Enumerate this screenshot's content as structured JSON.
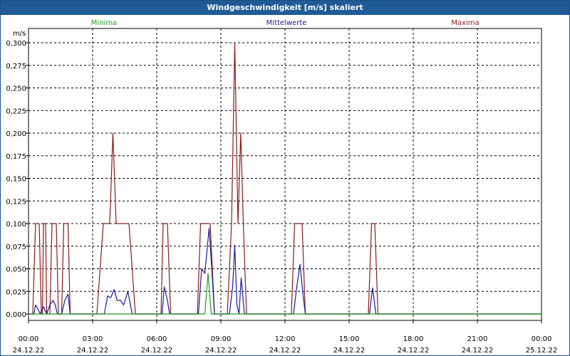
{
  "window": {
    "title": "Windgeschwindigkeit [m/s] skaliert"
  },
  "chart_data": {
    "type": "line",
    "title": "Windgeschwindigkeit [m/s] skaliert",
    "ylabel": "m/s",
    "xlabel": "",
    "ylim": [
      0,
      0.3
    ],
    "xlim": [
      0,
      24
    ],
    "y_ticks": [
      "0,000",
      "0,025",
      "0,050",
      "0,075",
      "0,100",
      "0,125",
      "0,150",
      "0,175",
      "0,200",
      "0,225",
      "0,250",
      "0,275",
      "0,300"
    ],
    "x_ticks": [
      {
        "time": "00:00",
        "date": "24.12.22"
      },
      {
        "time": "03:00",
        "date": "24.12.22"
      },
      {
        "time": "06:00",
        "date": "24.12.22"
      },
      {
        "time": "09:00",
        "date": "24.12.22"
      },
      {
        "time": "12:00",
        "date": "24.12.22"
      },
      {
        "time": "15:00",
        "date": "24.12.22"
      },
      {
        "time": "18:00",
        "date": "24.12.22"
      },
      {
        "time": "21:00",
        "date": "24.12.22"
      },
      {
        "time": "00:00",
        "date": "25.12.22"
      }
    ],
    "grid": true,
    "legend_position": "top",
    "series": [
      {
        "name": "Maxima",
        "color": "#8b1a1a",
        "points": [
          [
            0,
            0
          ],
          [
            0.2,
            0
          ],
          [
            0.33,
            0.1
          ],
          [
            0.5,
            0.1
          ],
          [
            0.6,
            0
          ],
          [
            0.65,
            0
          ],
          [
            0.7,
            0.1
          ],
          [
            0.8,
            0.1
          ],
          [
            0.85,
            0
          ],
          [
            1.0,
            0
          ],
          [
            1.1,
            0.1
          ],
          [
            1.3,
            0.1
          ],
          [
            1.4,
            0
          ],
          [
            1.55,
            0
          ],
          [
            1.65,
            0.1
          ],
          [
            1.85,
            0.1
          ],
          [
            1.95,
            0
          ],
          [
            3.0,
            0
          ],
          [
            3.2,
            0
          ],
          [
            3.5,
            0.1
          ],
          [
            3.8,
            0.1
          ],
          [
            3.95,
            0.2
          ],
          [
            4.1,
            0.1
          ],
          [
            4.7,
            0.1
          ],
          [
            5.0,
            0
          ],
          [
            6.2,
            0
          ],
          [
            6.3,
            0.1
          ],
          [
            6.5,
            0.1
          ],
          [
            6.65,
            0
          ],
          [
            7.9,
            0
          ],
          [
            8.05,
            0.1
          ],
          [
            8.5,
            0.1
          ],
          [
            8.7,
            0
          ],
          [
            9.3,
            0
          ],
          [
            9.5,
            0.1
          ],
          [
            9.65,
            0.3
          ],
          [
            9.8,
            0.1
          ],
          [
            9.93,
            0.2
          ],
          [
            10.05,
            0.1
          ],
          [
            10.2,
            0
          ],
          [
            12.3,
            0
          ],
          [
            12.45,
            0.1
          ],
          [
            12.8,
            0.1
          ],
          [
            12.95,
            0
          ],
          [
            15.9,
            0
          ],
          [
            16.05,
            0.1
          ],
          [
            16.2,
            0.1
          ],
          [
            16.35,
            0
          ],
          [
            24,
            0
          ]
        ]
      },
      {
        "name": "Mittelwerte",
        "color": "#1a1a9e",
        "points": [
          [
            0,
            0
          ],
          [
            0.25,
            0
          ],
          [
            0.33,
            0.01
          ],
          [
            0.45,
            0.005
          ],
          [
            0.55,
            0
          ],
          [
            0.7,
            0.008
          ],
          [
            0.85,
            0
          ],
          [
            1.0,
            0.01
          ],
          [
            1.15,
            0.015
          ],
          [
            1.25,
            0.01
          ],
          [
            1.35,
            0
          ],
          [
            1.55,
            0
          ],
          [
            1.7,
            0.015
          ],
          [
            1.85,
            0.022
          ],
          [
            1.95,
            0
          ],
          [
            3.55,
            0
          ],
          [
            3.7,
            0.02
          ],
          [
            3.85,
            0.018
          ],
          [
            4.0,
            0.027
          ],
          [
            4.15,
            0.015
          ],
          [
            4.3,
            0.015
          ],
          [
            4.45,
            0.01
          ],
          [
            4.65,
            0.025
          ],
          [
            4.85,
            0
          ],
          [
            6.25,
            0
          ],
          [
            6.35,
            0.03
          ],
          [
            6.5,
            0.015
          ],
          [
            6.6,
            0
          ],
          [
            7.95,
            0
          ],
          [
            8.1,
            0.05
          ],
          [
            8.25,
            0.045
          ],
          [
            8.45,
            0.095
          ],
          [
            8.6,
            0.04
          ],
          [
            8.7,
            0
          ],
          [
            9.4,
            0
          ],
          [
            9.55,
            0.03
          ],
          [
            9.65,
            0.076
          ],
          [
            9.75,
            0.01
          ],
          [
            9.85,
            0
          ],
          [
            9.95,
            0.04
          ],
          [
            10.1,
            0
          ],
          [
            12.4,
            0
          ],
          [
            12.55,
            0.03
          ],
          [
            12.7,
            0.055
          ],
          [
            12.85,
            0.02
          ],
          [
            12.95,
            0
          ],
          [
            15.95,
            0
          ],
          [
            16.1,
            0.029
          ],
          [
            16.25,
            0
          ],
          [
            24,
            0
          ]
        ]
      },
      {
        "name": "Minima",
        "color": "#1e9e1e",
        "points": [
          [
            0,
            0
          ],
          [
            8.25,
            0
          ],
          [
            8.4,
            0.045
          ],
          [
            8.55,
            0
          ],
          [
            24,
            0
          ]
        ]
      }
    ]
  }
}
